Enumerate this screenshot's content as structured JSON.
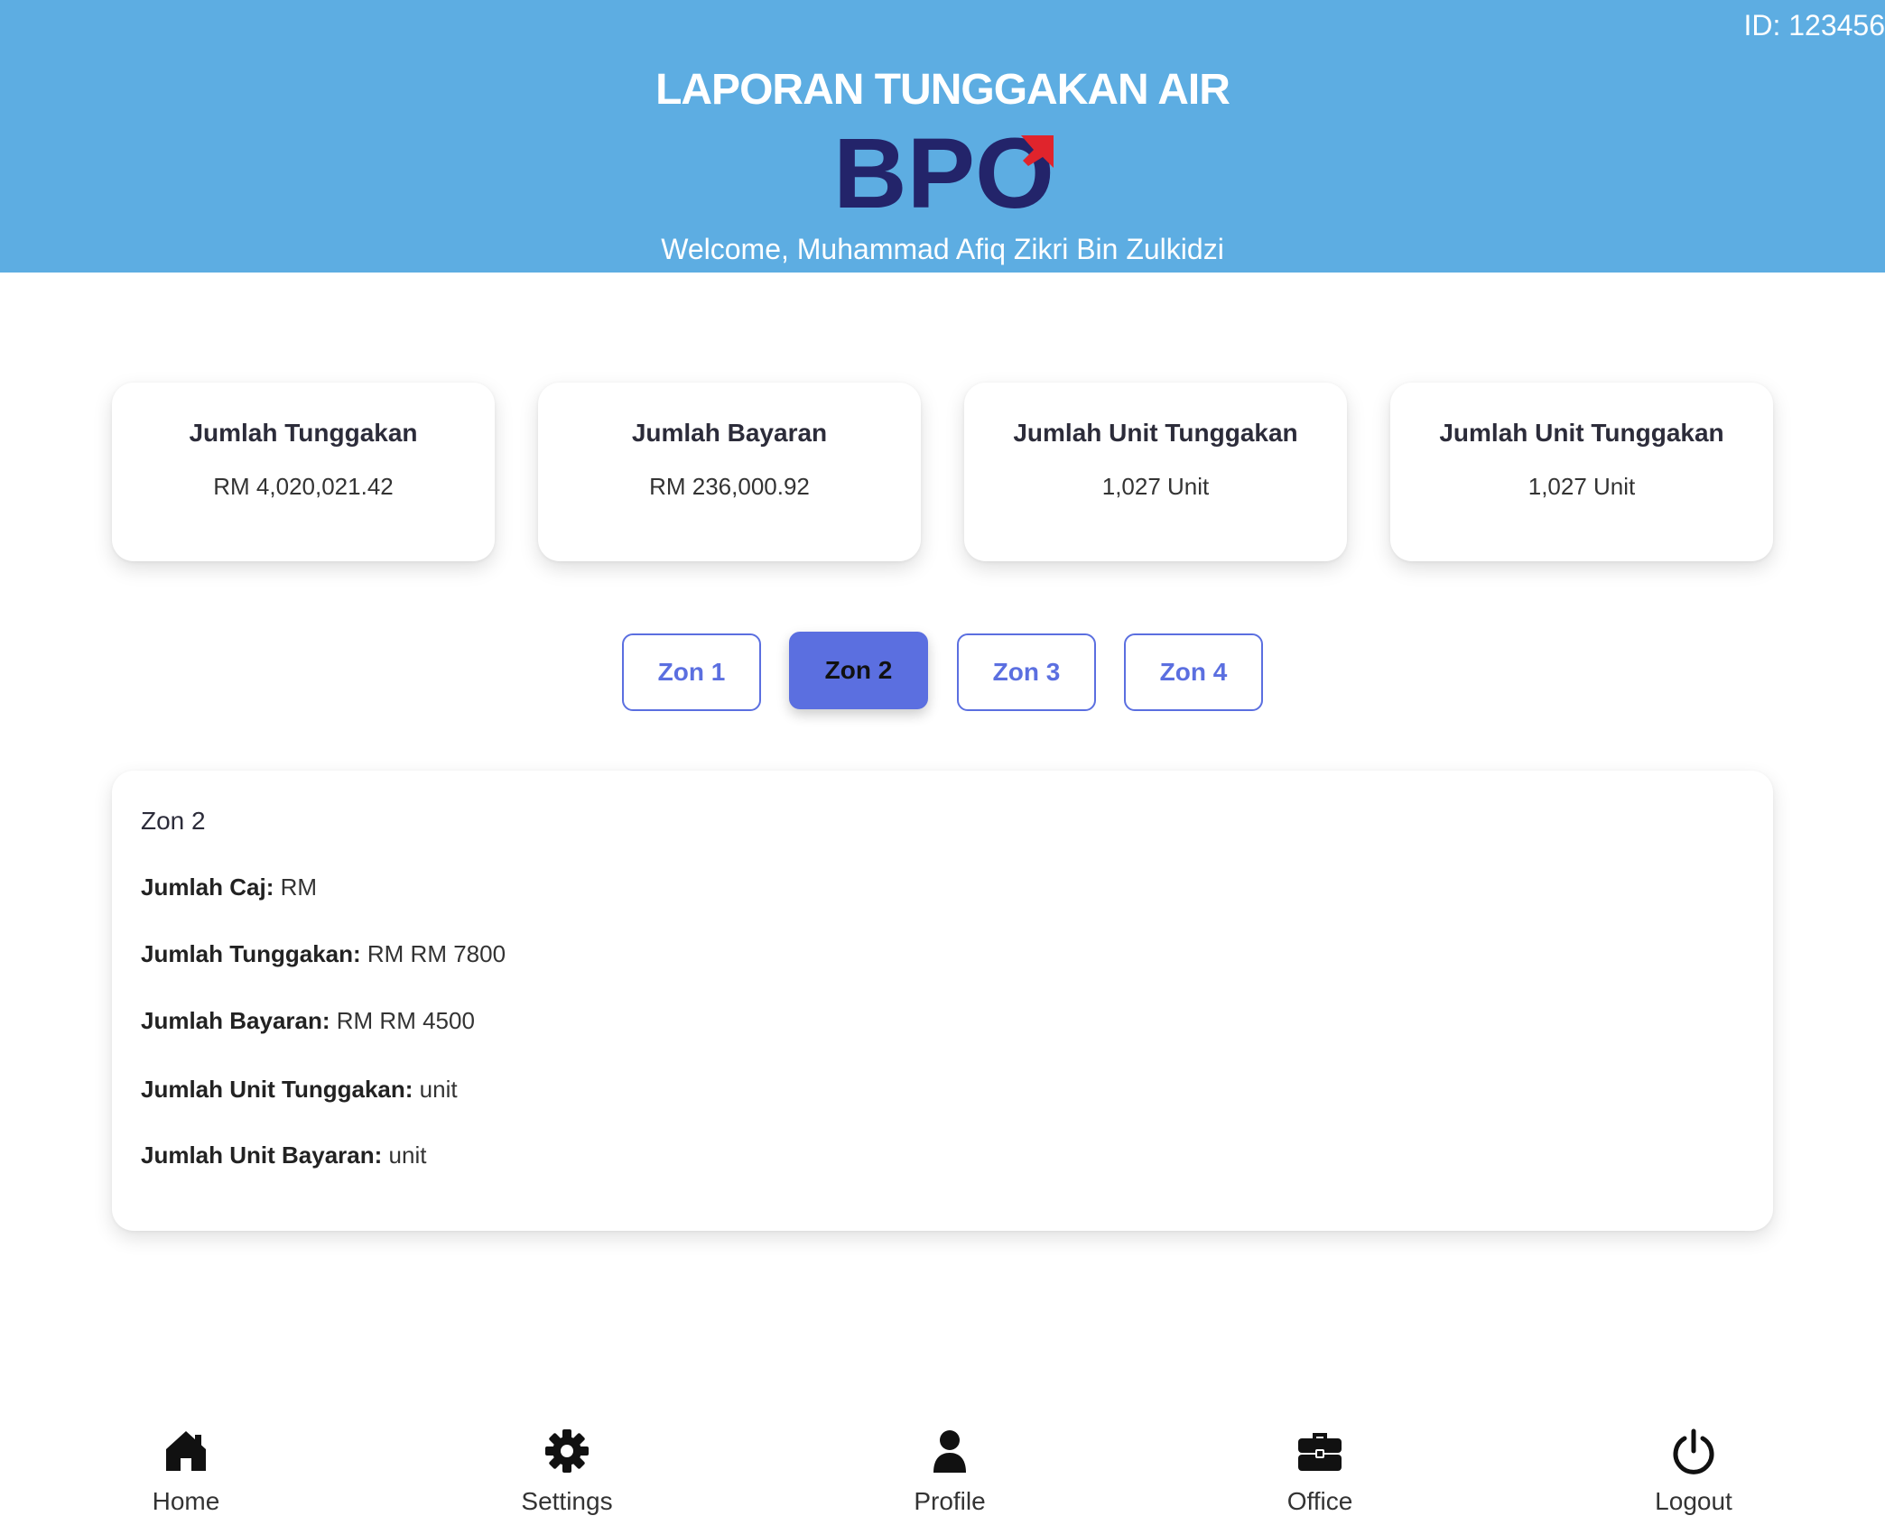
{
  "header": {
    "user_id": "ID: 123456",
    "title": "LAPORAN TUNGGAKAN AIR",
    "logo_text": "BPO",
    "welcome": "Welcome, Muhammad Afiq Zikri Bin Zulkidzi"
  },
  "summary_cards": [
    {
      "title": "Jumlah Tunggakan",
      "value": "RM 4,020,021.42"
    },
    {
      "title": "Jumlah Bayaran",
      "value": "RM 236,000.92"
    },
    {
      "title": "Jumlah Unit Tunggakan",
      "value": "1,027 Unit"
    },
    {
      "title": "Jumlah Unit Tunggakan",
      "value": "1,027 Unit"
    }
  ],
  "zone_tabs": [
    {
      "label": "Zon 1",
      "active": false
    },
    {
      "label": "Zon 2",
      "active": true
    },
    {
      "label": "Zon 3",
      "active": false
    },
    {
      "label": "Zon 4",
      "active": false
    }
  ],
  "zone_detail": {
    "title": "Zon 2",
    "rows": [
      {
        "label": "Jumlah Caj:",
        "value": "RM"
      },
      {
        "label": "Jumlah Tunggakan:",
        "value": "RM RM 7800"
      },
      {
        "label": "Jumlah Bayaran:",
        "value": "RM RM 4500"
      },
      {
        "label": "Jumlah Unit Tunggakan:",
        "value": "unit"
      },
      {
        "label": "Jumlah Unit Bayaran:",
        "value": "unit"
      }
    ]
  },
  "bottom_nav": [
    {
      "label": "Home",
      "icon": "home-icon"
    },
    {
      "label": "Settings",
      "icon": "gear-icon"
    },
    {
      "label": "Profile",
      "icon": "user-icon"
    },
    {
      "label": "Office",
      "icon": "briefcase-icon"
    },
    {
      "label": "Logout",
      "icon": "power-icon"
    }
  ],
  "colors": {
    "header_bg": "#5dade2",
    "accent": "#5b6fe0",
    "logo_navy": "#23246a",
    "logo_red": "#e0242c"
  }
}
